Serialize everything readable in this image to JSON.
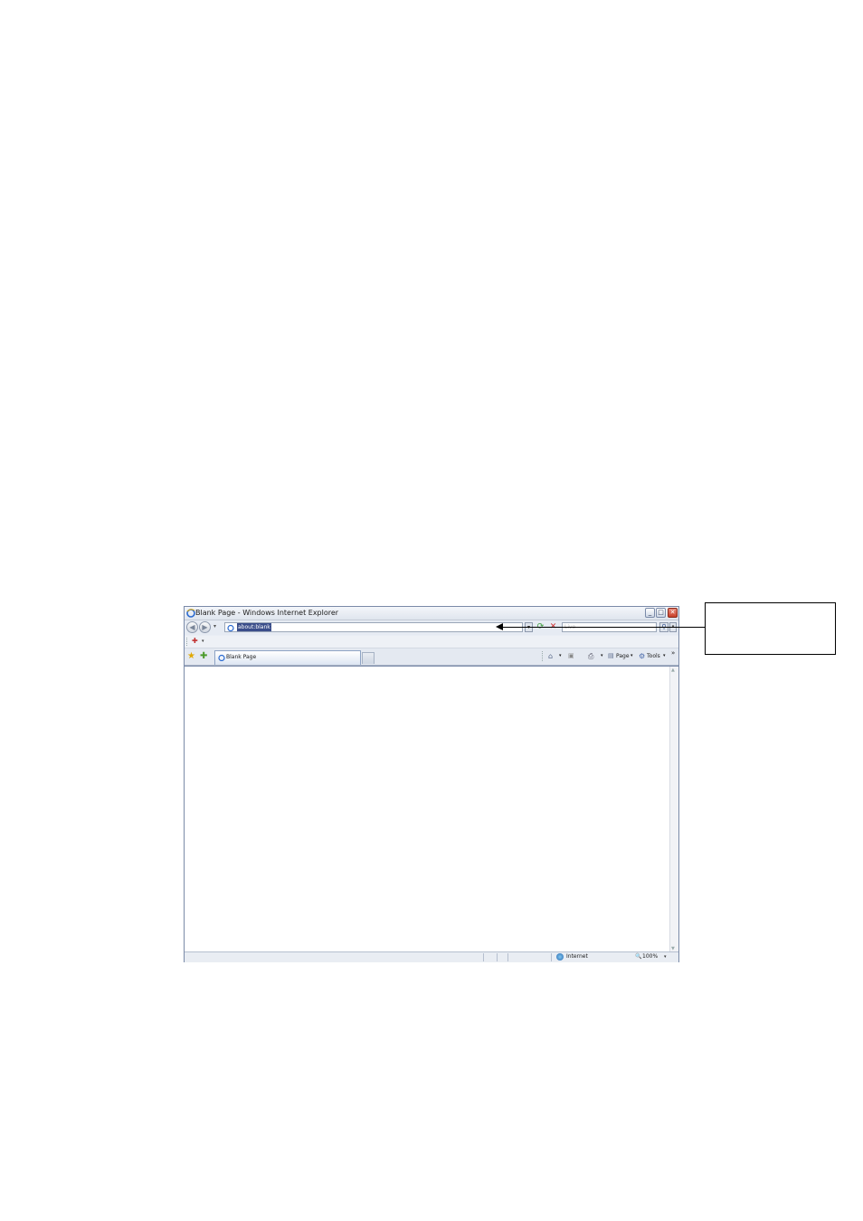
{
  "window": {
    "title": "Blank Page - Windows Internet Explorer",
    "min_glyph": "_",
    "max_glyph": "□",
    "close_glyph": "✕"
  },
  "navbar": {
    "back_glyph": "◀",
    "forward_glyph": "▶",
    "history_dropdown_glyph": "▾",
    "address": "about:blank",
    "address_dropdown_glyph": "▾",
    "refresh_glyph": "⟳",
    "stop_glyph": "✕",
    "search_placeholder": "Live",
    "search_glyph": "⚲",
    "search_options_glyph": "▾"
  },
  "addonbar": {
    "addon_icon": "✚",
    "addon_dropdown_glyph": "▾"
  },
  "tabbar": {
    "favorites_glyph": "★",
    "add_favorite_glyph": "✚",
    "active_tab_label": "Blank Page",
    "commands": {
      "home_glyph": "⌂",
      "home_dropdown_glyph": "▾",
      "feeds_glyph": "▣",
      "print_glyph": "⎙",
      "print_dropdown_glyph": "▾",
      "page_glyph": "▤",
      "page_label": "Page",
      "page_dropdown_glyph": "▾",
      "tools_glyph": "⚙",
      "tools_label": "Tools",
      "tools_dropdown_glyph": "▾",
      "more_glyph": "»"
    }
  },
  "scrollbar": {
    "up_glyph": "▲",
    "down_glyph": "▼"
  },
  "statusbar": {
    "zone_label": "Internet",
    "zoom_glyph": "🔍",
    "zoom_label": "100%",
    "zoom_dropdown_glyph": "▾"
  },
  "colors": {
    "window_border": "#7a8aa8",
    "chrome_bg": "#e6ebf3",
    "address_highlight": "#3a4d8a",
    "close_button": "#c8402a"
  }
}
